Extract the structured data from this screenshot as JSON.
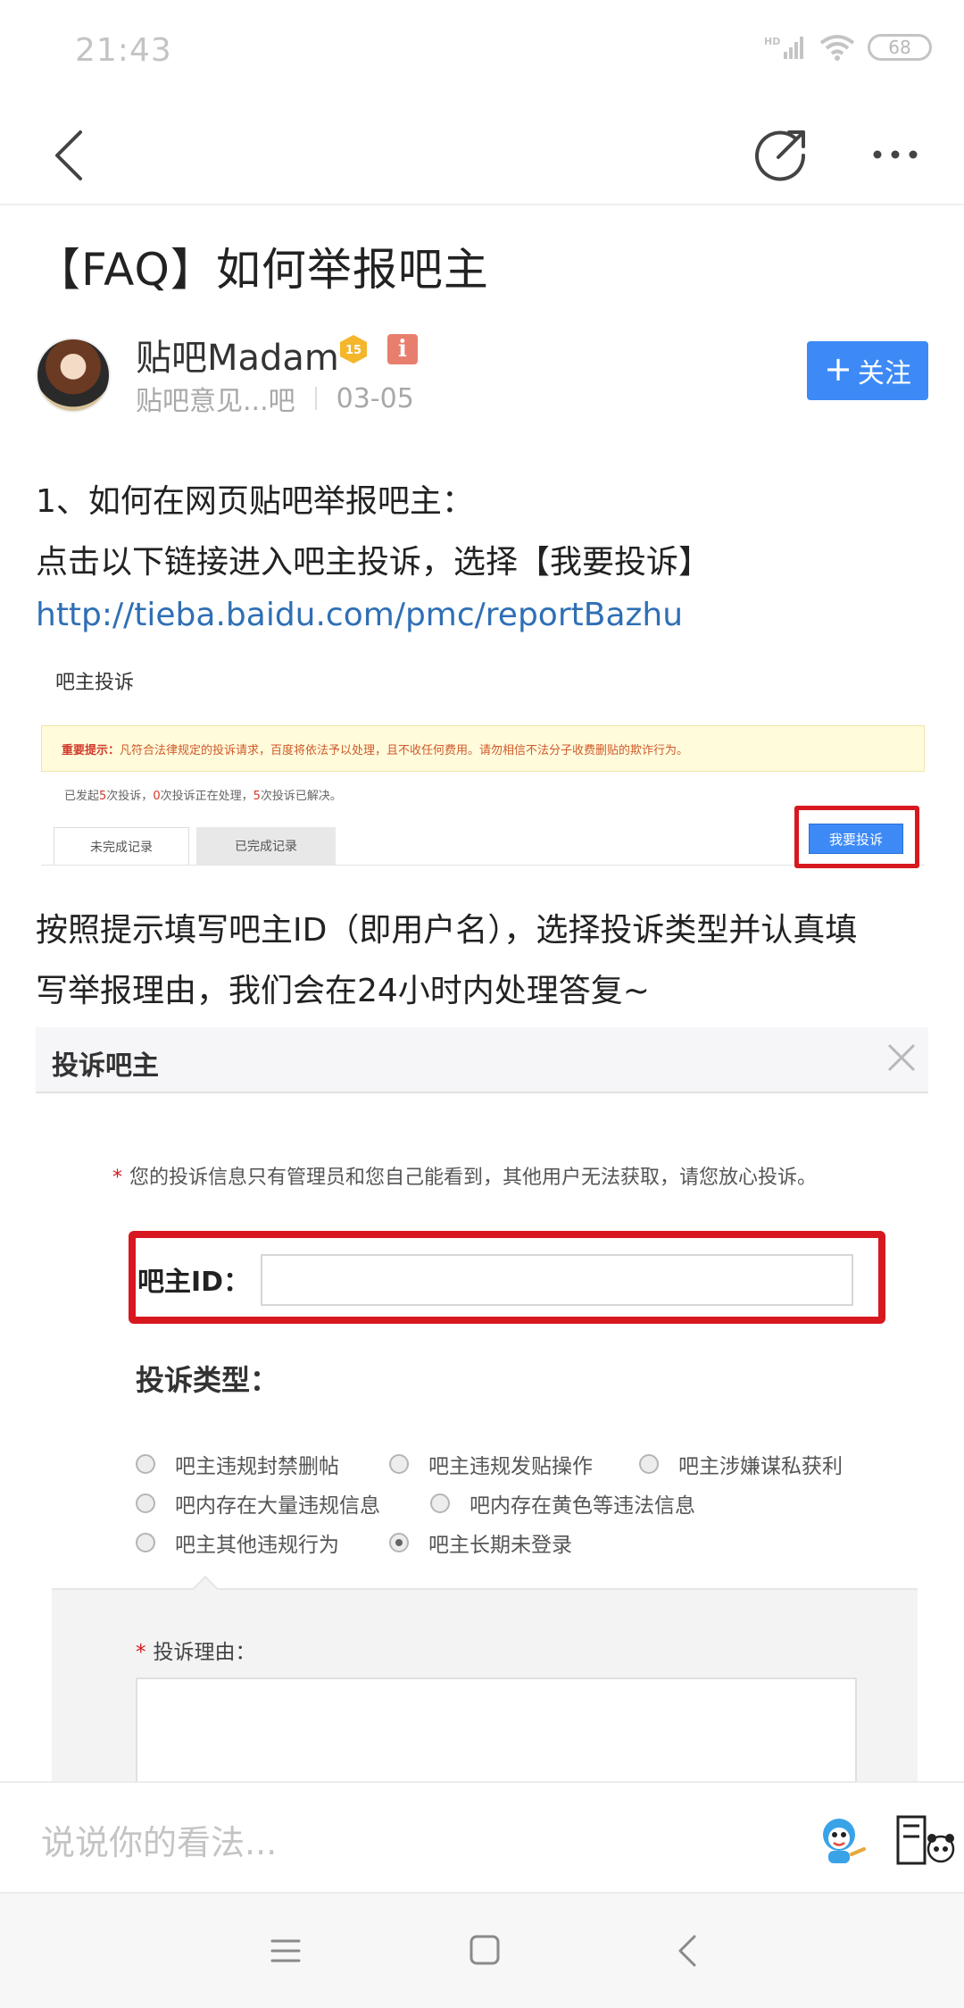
{
  "status_bar": {
    "time": "21:43",
    "battery": "68"
  },
  "post": {
    "title": "【FAQ】如何举报吧主",
    "author": "贴吧Madam",
    "level": "15",
    "info_badge": "i",
    "source": "贴吧意见...吧",
    "date": "03-05",
    "follow_label": "关注"
  },
  "content": {
    "line1": "1、如何在网页贴吧举报吧主：",
    "line2": "点击以下链接进入吧主投诉，选择【我要投诉】",
    "link": "http://tieba.baidu.com/pmc/reportBazhu",
    "line3": "按照提示填写吧主ID（即用户名），选择投诉类型并认真填",
    "line4": "写举报理由，我们会在24小时内处理答复~"
  },
  "screenshot1": {
    "title": "吧主投诉",
    "notice_bold": "重要提示：",
    "notice_text": "凡符合法律规定的投诉请求，百度将依法予以处理，且不收任何费用。请勿相信不法分子收费删贴的欺诈行为。",
    "count_prefix": "已发起",
    "count_a": "5",
    "count_mid1": "次投诉，",
    "count_b": "0",
    "count_mid2": "次投诉正在处理，",
    "count_c": "5",
    "count_suffix": "次投诉已解决。",
    "tab_incomplete": "未完成记录",
    "tab_complete": "已完成记录",
    "complain_button": "我要投诉"
  },
  "screenshot2": {
    "title": "投诉吧主",
    "note_star": "*",
    "note": "您的投诉信息只有管理员和您自己能看到，其他用户无法获取，请您放心投诉。",
    "id_label": "吧主ID：",
    "type_label": "投诉类型：",
    "options": [
      "吧主违规封禁删帖",
      "吧主违规发贴操作",
      "吧主涉嫌谋私获利",
      "吧内存在大量违规信息",
      "吧内存在黄色等违法信息",
      "吧主其他违规行为",
      "吧主长期未登录"
    ],
    "selected_option": "吧主长期未登录",
    "reason_star": "*",
    "reason_label": "投诉理由："
  },
  "comment_bar": {
    "placeholder": "说说你的看法..."
  },
  "colors": {
    "accent": "#3d8af7",
    "link": "#2f6fb5",
    "highlight_red": "#d8181f"
  }
}
